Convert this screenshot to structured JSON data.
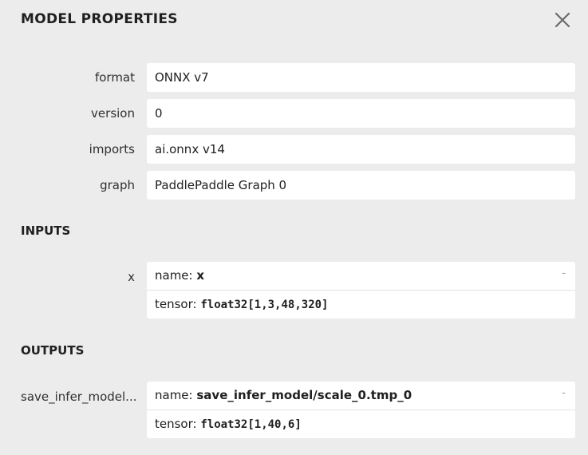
{
  "title": "MODEL PROPERTIES",
  "properties": [
    {
      "label": "format",
      "value": "ONNX v7"
    },
    {
      "label": "version",
      "value": "0"
    },
    {
      "label": "imports",
      "value": "ai.onnx v14"
    },
    {
      "label": "graph",
      "value": "PaddlePaddle Graph 0"
    }
  ],
  "inputs": {
    "heading": "INPUTS",
    "items": [
      {
        "label": "x",
        "name_prefix": "name: ",
        "name": "x",
        "tensor_prefix": "tensor: ",
        "tensor": "float32[1,3,48,320]",
        "toggle": "-"
      }
    ]
  },
  "outputs": {
    "heading": "OUTPUTS",
    "items": [
      {
        "label": "save_infer_model...",
        "name_prefix": "name: ",
        "name": "save_infer_model/scale_0.tmp_0",
        "tensor_prefix": "tensor: ",
        "tensor": "float32[1,40,6]",
        "toggle": "-"
      }
    ]
  },
  "icons": {
    "close": "close-icon"
  }
}
